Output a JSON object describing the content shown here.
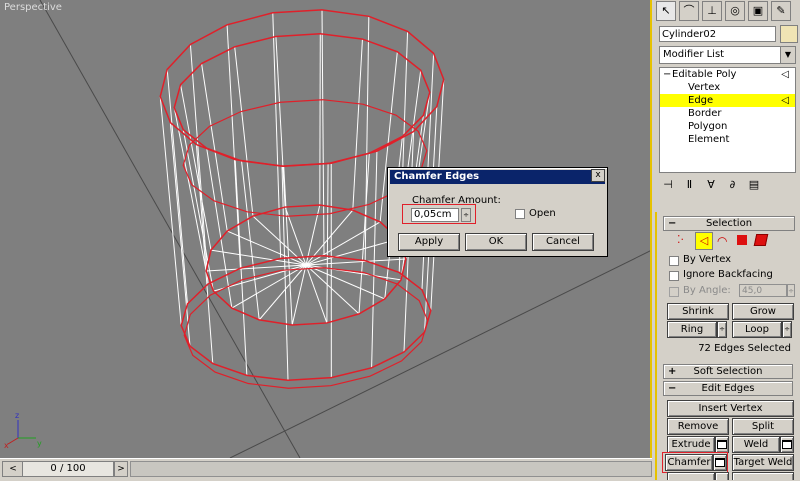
{
  "viewport": {
    "label": "Perspective"
  },
  "axis": {
    "x": "x",
    "y": "y",
    "z": "z"
  },
  "timebar": {
    "prev": "<",
    "frame_display": "0 / 100",
    "next": ">"
  },
  "panel": {
    "tabs": [
      "create-tab-icon",
      "modify-tab-icon",
      "hierarchy-tab-icon",
      "motion-tab-icon",
      "display-tab-icon",
      "utilities-tab-icon"
    ],
    "object_name": "Cylinder02",
    "modifier_list": "Modifier List",
    "stack": [
      {
        "label": "Editable Poly"
      },
      {
        "label": "Vertex"
      },
      {
        "label": "Edge"
      },
      {
        "label": "Border"
      },
      {
        "label": "Polygon"
      },
      {
        "label": "Element"
      }
    ]
  },
  "selection": {
    "title": "Selection",
    "by_vertex": "By Vertex",
    "ignore_backfacing": "Ignore Backfacing",
    "by_angle": "By Angle:",
    "angle_value": "45,0",
    "shrink": "Shrink",
    "grow": "Grow",
    "ring": "Ring",
    "loop": "Loop",
    "status": "72 Edges Selected"
  },
  "soft_selection": {
    "title": "Soft Selection"
  },
  "edit_edges": {
    "title": "Edit Edges",
    "insert_vertex": "Insert Vertex",
    "remove": "Remove",
    "split": "Split",
    "extrude": "Extrude",
    "weld": "Weld",
    "chamfer": "Chamfer",
    "target_weld": "Target Weld"
  },
  "dialog": {
    "title": "Chamfer Edges",
    "close": "x",
    "amount_label": "Chamfer Amount:",
    "amount_value": "0,05cm",
    "open_label": "Open",
    "apply": "Apply",
    "ok": "OK",
    "cancel": "Cancel"
  },
  "colors": {
    "accent": "#e6c200",
    "highlight_red": "#e0202a",
    "title_bar": "#0a246a",
    "viewport_bg": "#7f7f7f"
  }
}
